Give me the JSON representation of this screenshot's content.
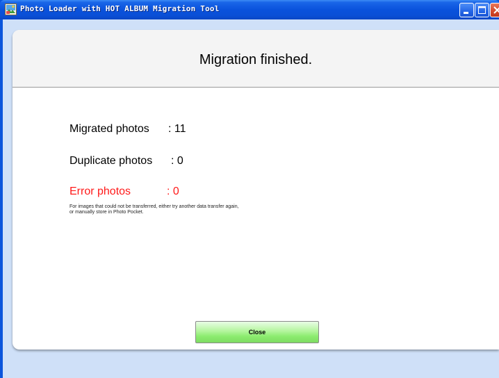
{
  "window": {
    "title": "Photo Loader with HOT ALBUM Migration Tool",
    "icons": {
      "app": "photo-loader-app-icon",
      "minimize": "minimize-icon",
      "maximize": "maximize-icon",
      "close": "close-icon"
    }
  },
  "dialog": {
    "heading": "Migration finished.",
    "stats": {
      "migrated_label": "Migrated photos",
      "migrated_value": ": 11",
      "duplicate_label": "Duplicate photos",
      "duplicate_value": ": 0",
      "error_label": "Error photos",
      "error_value": ": 0"
    },
    "note_line1": "For images that could not be transferred, either try another data transfer again,",
    "note_line2": "or manually store in Photo Pocket.",
    "close_label": "Close"
  },
  "colors": {
    "titlebar": "#0a52dc",
    "error_text": "#ff1a1a",
    "close_button": "#b4f59d",
    "client_background": "#cfe0f8"
  }
}
